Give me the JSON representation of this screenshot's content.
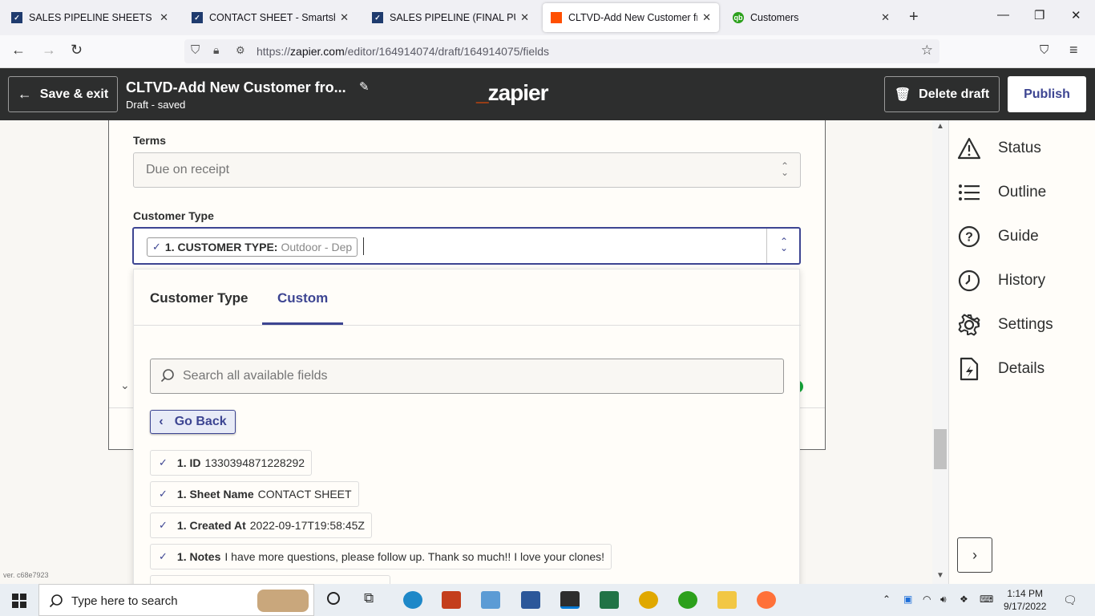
{
  "browser": {
    "tabs": [
      {
        "title": "SALES PIPELINE SHEETS - Smart",
        "favicon_color": "#1f3b6e",
        "active": false
      },
      {
        "title": "CONTACT SHEET - Smartsheet.c",
        "favicon_color": "#1f3b6e",
        "active": false
      },
      {
        "title": "SALES PIPELINE (FINAL PURCHA",
        "favicon_color": "#1f3b6e",
        "active": false
      },
      {
        "title": "CLTVD-Add New Customer fron",
        "favicon_color": "#ff4f00",
        "active": true
      },
      {
        "title": "Customers",
        "favicon_color": "#2ca01c",
        "active": false
      }
    ],
    "url_prefix": "https://",
    "url_domain": "zapier.com",
    "url_path": "/editor/164914074/draft/164914075/fields"
  },
  "header": {
    "save_exit": "Save & exit",
    "zap_title": "CLTVD-Add New Customer fro...",
    "zap_status": "Draft - saved",
    "logo": "zapier",
    "delete_draft": "Delete draft",
    "publish": "Publish"
  },
  "form": {
    "terms_label": "Terms",
    "terms_placeholder": "Due on receipt",
    "customer_type_label": "Customer Type",
    "customer_type_pill_label": "1. CUSTOMER TYPE:",
    "customer_type_pill_value": "Outdoor - Dep"
  },
  "dropdown": {
    "tabs": [
      "Customer Type",
      "Custom"
    ],
    "active_tab": "Custom",
    "search_placeholder": "Search all available fields",
    "go_back": "Go Back",
    "fields": [
      {
        "label": "1. ID",
        "value": "1330394871228292"
      },
      {
        "label": "1. Sheet Name",
        "value": "CONTACT SHEET"
      },
      {
        "label": "1. Created At",
        "value": "2022-09-17T19:58:45Z"
      },
      {
        "label": "1. Notes",
        "value": "I have more questions, please follow up. Thank so much!! I love your clones!"
      }
    ]
  },
  "sidebar": {
    "items": [
      {
        "label": "Status",
        "icon": "warning-icon"
      },
      {
        "label": "Outline",
        "icon": "list-icon"
      },
      {
        "label": "Guide",
        "icon": "question-icon"
      },
      {
        "label": "History",
        "icon": "clock-icon"
      },
      {
        "label": "Settings",
        "icon": "gear-icon"
      },
      {
        "label": "Details",
        "icon": "file-bolt-icon"
      }
    ]
  },
  "version": "ver. c68e7923",
  "taskbar": {
    "search_placeholder": "Type here to search",
    "time": "1:14 PM",
    "date": "9/17/2022"
  }
}
